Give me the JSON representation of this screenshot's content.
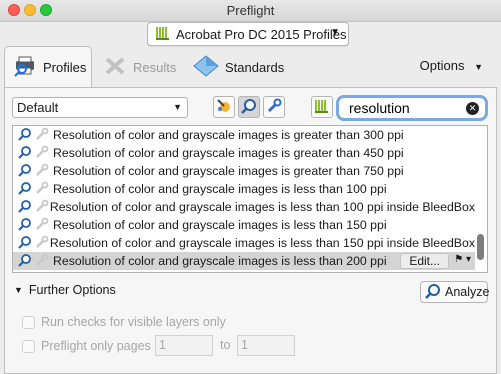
{
  "window": {
    "title": "Preflight"
  },
  "profile_selector": {
    "label": "Acrobat Pro DC 2015 Profiles",
    "icon": "library-bars-icon",
    "icon_color": "#8bbf2b"
  },
  "tabs": [
    {
      "label": "Profiles",
      "icon": "printer-magnifier-icon",
      "active": true
    },
    {
      "label": "Results",
      "icon": "wrench-cross-icon",
      "active": false
    },
    {
      "label": "Standards",
      "icon": "blue-diamond-icon",
      "active": false
    }
  ],
  "options": {
    "label": "Options"
  },
  "filter_dropdown": {
    "value": "Default"
  },
  "tool_buttons": [
    {
      "icon": "fixup-wand-icon",
      "active": false
    },
    {
      "icon": "magnifier-icon",
      "active": true
    },
    {
      "icon": "wrench-icon",
      "active": false
    },
    {
      "icon": "library-bars-icon",
      "active": false
    }
  ],
  "search": {
    "value": "resolution",
    "clear_icon": "clear-x-icon"
  },
  "rows": [
    {
      "text": "Resolution of color and grayscale images is greater than 300 ppi",
      "selected": false
    },
    {
      "text": "Resolution of color and grayscale images is greater than 450 ppi",
      "selected": false
    },
    {
      "text": "Resolution of color and grayscale images is greater than 750 ppi",
      "selected": false
    },
    {
      "text": "Resolution of color and grayscale images is less than 100 ppi",
      "selected": false
    },
    {
      "text": "Resolution of color and grayscale images is less than 100 ppi inside BleedBox",
      "selected": false
    },
    {
      "text": "Resolution of color and grayscale images is less than 150 ppi",
      "selected": false
    },
    {
      "text": "Resolution of color and grayscale images is less than 150 ppi inside BleedBox",
      "selected": false
    },
    {
      "text": "Resolution of color and grayscale images is less than 200 ppi",
      "selected": true
    }
  ],
  "row_actions": {
    "edit_label": "Edit..."
  },
  "further": {
    "label": "Further Options"
  },
  "analyze": {
    "label": "Analyze"
  },
  "checks": {
    "visible_layers": {
      "label": "Run checks for visible layers only"
    },
    "only_pages": {
      "label": "Preflight only pages",
      "from": "1",
      "to_label": "to",
      "to": "1"
    }
  }
}
